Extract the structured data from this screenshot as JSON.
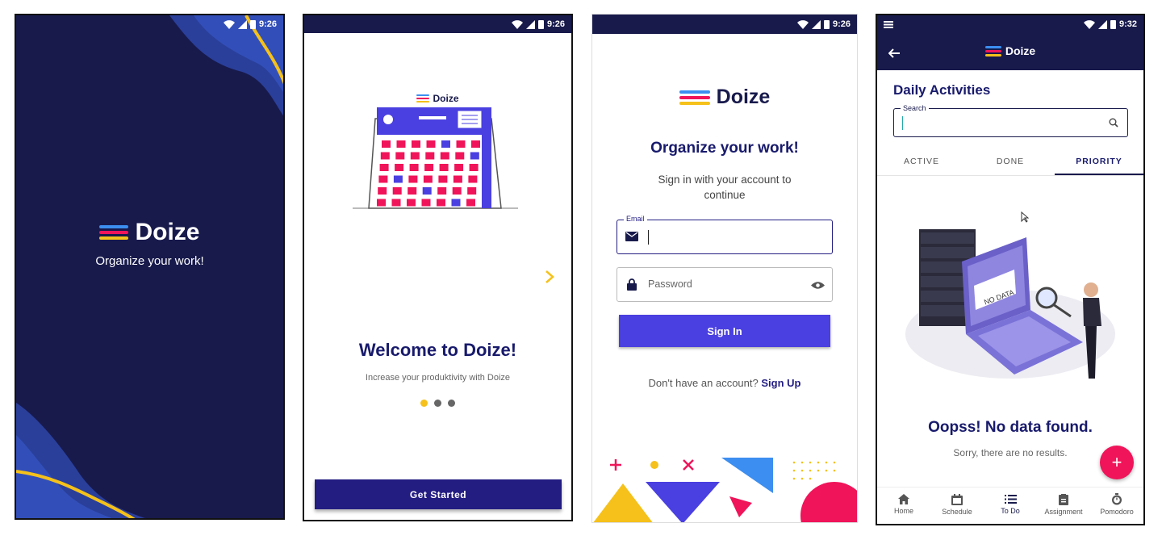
{
  "status": {
    "time_a": "9:26",
    "time_d": "9:32"
  },
  "splash": {
    "brand": "Doize",
    "tagline": "Organize your work!"
  },
  "onboarding": {
    "brand": "Doize",
    "title": "Welcome to Doize!",
    "subtitle": "Increase your produktivity with Doize",
    "next_icon": "chevron-right-icon",
    "cta": "Get Started"
  },
  "login": {
    "brand": "Doize",
    "heading": "Organize your work!",
    "subheading": "Sign in with your account to continue",
    "email_label": "Email",
    "email_value": "",
    "password_placeholder": "Password",
    "sign_in": "Sign In",
    "no_account": "Don't have an account?",
    "sign_up": "Sign Up"
  },
  "todo": {
    "brand": "Doize",
    "title": "Daily Activities",
    "search_label": "Search",
    "search_value": "",
    "tabs": [
      "ACTIVE",
      "DONE",
      "PRIORITY"
    ],
    "active_tab": "PRIORITY",
    "illustration_text": "NO DATA",
    "empty_title": "Oopss! No data found.",
    "empty_sub": "Sorry, there are no results.",
    "fab": "+",
    "nav": [
      {
        "label": "Home",
        "icon": "home-icon"
      },
      {
        "label": "Schedule",
        "icon": "calendar-icon"
      },
      {
        "label": "To Do",
        "icon": "list-icon"
      },
      {
        "label": "Assignment",
        "icon": "clipboard-icon"
      },
      {
        "label": "Pomodoro",
        "icon": "stopwatch-icon"
      }
    ],
    "active_nav": "To Do"
  },
  "colors": {
    "navy": "#181a4c",
    "indigo": "#4a3fe0",
    "deep_indigo": "#231d82",
    "yellow": "#f5c11a",
    "pink": "#f0145a",
    "blue": "#3c8ef0"
  }
}
